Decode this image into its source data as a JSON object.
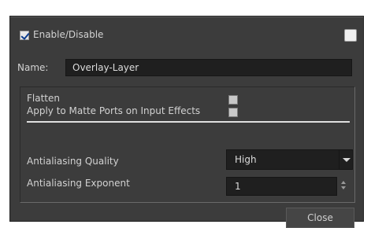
{
  "header": {
    "enable_label": "Enable/Disable",
    "enable_checked": true,
    "color_swatch": "#f0f0f0"
  },
  "name_field": {
    "label": "Name:",
    "value": "Overlay-Layer"
  },
  "options": {
    "flatten_label": "Flatten",
    "flatten_checked": false,
    "apply_matte_label": "Apply to Matte Ports on Input Effects",
    "apply_matte_checked": false,
    "aa_quality_label": "Antialiasing Quality",
    "aa_quality_value": "High",
    "aa_exponent_label": "Antialiasing Exponent",
    "aa_exponent_value": "1"
  },
  "footer": {
    "close_label": "Close"
  },
  "colors": {
    "panel_bg": "#3c3c3c",
    "field_bg": "#1f1f1f",
    "text": "#d2d2d2"
  }
}
